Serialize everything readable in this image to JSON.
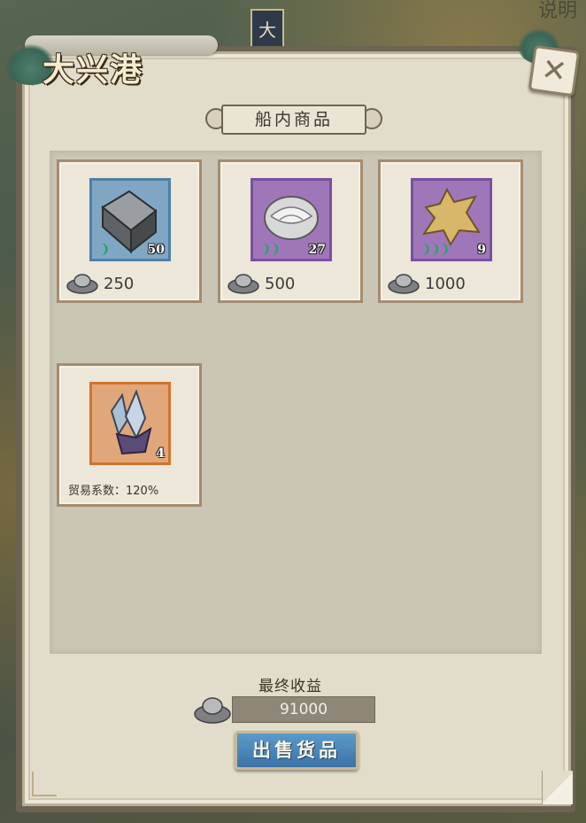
{
  "map": {
    "top_right_label": "说明",
    "banner_char": "大"
  },
  "title": "大兴港",
  "section_title": "船内商品",
  "goods": [
    {
      "name": "铁锭",
      "icon": "iron-ingot-icon",
      "frame": "blue",
      "count": "50",
      "quality": 1,
      "price": "250"
    },
    {
      "name": "丝绸",
      "icon": "silk-icon",
      "frame": "purple",
      "count": "27",
      "quality": 2,
      "price": "500"
    },
    {
      "name": "兽皮",
      "icon": "fur-pelt-icon",
      "frame": "purple",
      "count": "9",
      "quality": 3,
      "price": "1000"
    },
    {
      "name": "水晶",
      "icon": "crystal-icon",
      "frame": "orange",
      "count": "4",
      "quality": 0,
      "trade_text": "贸易系数：120%"
    }
  ],
  "profit": {
    "label": "最终收益",
    "value": "91000"
  },
  "sell_button": "出售货品",
  "close_button": "close",
  "colors": {
    "panel": "#e2dccb",
    "goods_area": "#cbc5b3",
    "card_border": "#a48c6f",
    "sell_button": "#3b74a7",
    "quality_green": "#28a36a"
  }
}
